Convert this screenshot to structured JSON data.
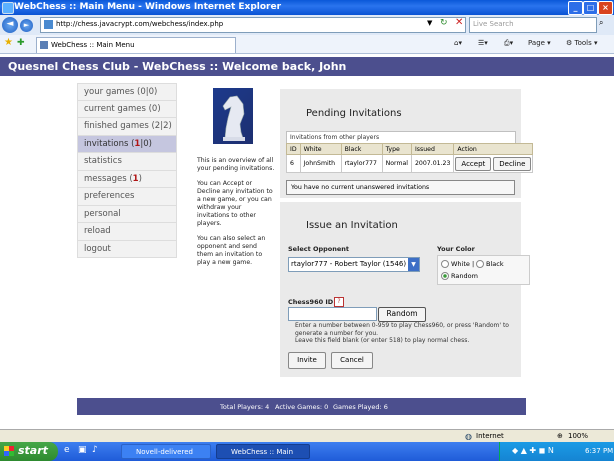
{
  "window": {
    "title": "WebChess :: Main Menu - Windows Internet Explorer"
  },
  "browser": {
    "url": "http://chess.javacrypt.com/webchess/index.php",
    "search_placeholder": "Live Search",
    "tab_label": "WebChess :: Main Menu",
    "page_menu": "Page",
    "tools_menu": "Tools"
  },
  "header": {
    "title": "Quesnel Chess Club - WebChess :: Welcome back, John"
  },
  "sidebar": {
    "items": [
      {
        "label": "your games (0|0)"
      },
      {
        "label": "current games (0)"
      },
      {
        "label": "finished games (2|2)"
      },
      {
        "label": "invitations (",
        "count": "1",
        "rest": "|0)"
      },
      {
        "label": "statistics"
      },
      {
        "label": "messages (",
        "count": "1",
        "rest": ")"
      },
      {
        "label": "preferences"
      },
      {
        "label": "personal"
      },
      {
        "label": "reload"
      },
      {
        "label": "logout"
      }
    ]
  },
  "info": {
    "p1": "This is an overview of all your pending invitations.",
    "p2": "You can Accept or Decline any invitation to a new game, or you can withdraw your invitations to other players.",
    "p3": "You can also select an opponent and send them an invitation to play a new game."
  },
  "pending": {
    "title": "Pending Invitations",
    "caption": "Invitations from other players",
    "columns": [
      "ID",
      "White",
      "Black",
      "Type",
      "Issued",
      "Action"
    ],
    "rows": [
      {
        "id": "6",
        "white": "JohnSmith",
        "black": "rtaylor777",
        "type": "Normal",
        "issued": "2007.01.23",
        "accept": "Accept",
        "decline": "Decline"
      }
    ],
    "no_outgoing": "You have no current unanswered invitations"
  },
  "issue": {
    "title": "Issue an Invitation",
    "select_label": "Select Opponent",
    "opponent": "rtaylor777 - Robert Taylor (1546)",
    "color_label": "Your Color",
    "color_white": "White",
    "color_black": "Black",
    "color_random": "Random",
    "c960_label": "Chess960 ID",
    "c960_help_icon": "?",
    "random_button": "Random",
    "c960_help": "Enter a number between 0-959 to play Chess960, or press 'Random' to generate a number for you.",
    "c960_help2": "Leave this field blank (or enter 518) to play normal chess.",
    "invite_button": "Invite",
    "cancel_button": "Cancel"
  },
  "footer": {
    "total_players": "Total Players: 4",
    "active_games": "Active Games: 0",
    "games_played": "Games Played: 6"
  },
  "status": {
    "zone": "Internet",
    "zoom": "100%"
  },
  "taskbar": {
    "start": "start",
    "task1": "Novell-delivered Appli...",
    "task2": "WebChess :: Main Me...",
    "time": "6:37 PM"
  }
}
